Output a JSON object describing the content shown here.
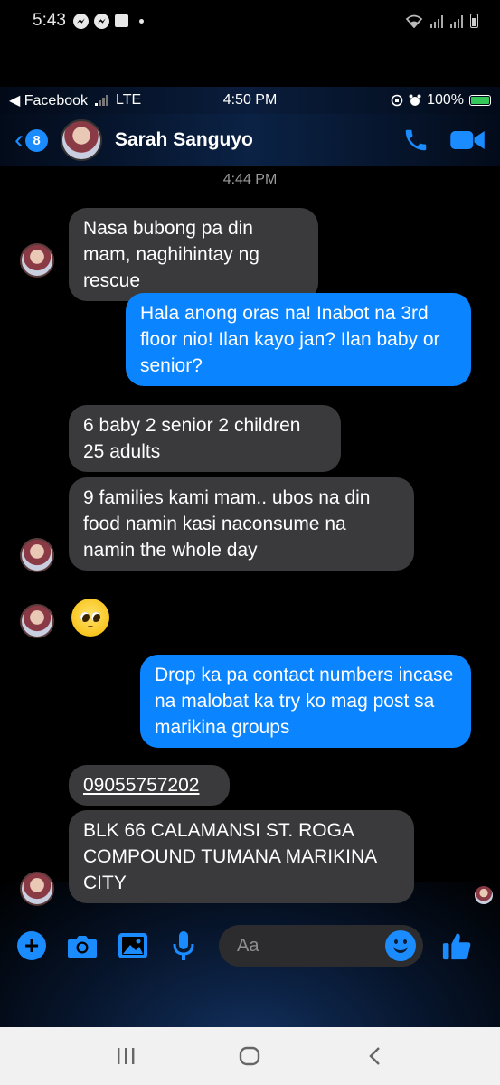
{
  "android_status": {
    "time": "5:43"
  },
  "ios_status": {
    "carrier": "◀ Facebook",
    "network": "LTE",
    "time": "4:50 PM",
    "battery": "100%"
  },
  "header": {
    "back_count": "8",
    "contact_name": "Sarah Sanguyo"
  },
  "timestamp": "4:44 PM",
  "messages": [
    {
      "from": "them",
      "text": "Nasa bubong pa din mam, naghihintay ng rescue"
    },
    {
      "from": "me",
      "text": "Hala anong oras na! Inabot na 3rd floor nio! Ilan kayo jan? Ilan baby or senior?"
    },
    {
      "from": "them",
      "text": "6 baby 2 senior 2 children 25 adults"
    },
    {
      "from": "them",
      "text": "9 families kami mam.. ubos na din food namin kasi naconsume na namin the whole day"
    },
    {
      "from": "them",
      "type": "emoji",
      "icon": "pleading-face-emoji"
    },
    {
      "from": "me",
      "text": "Drop ka pa contact numbers incase na malobat ka try ko mag post sa marikina groups"
    },
    {
      "from": "them",
      "text": "09055757202"
    },
    {
      "from": "them",
      "text": "BLK 66 CALAMANSI ST. ROGA COMPOUND TUMANA MARIKINA CITY"
    }
  ],
  "composer": {
    "placeholder": "Aa"
  },
  "colors": {
    "accent": "#1a8cff",
    "outgoing_bubble": "#0a84ff",
    "incoming_bubble": "#3a3a3c"
  }
}
